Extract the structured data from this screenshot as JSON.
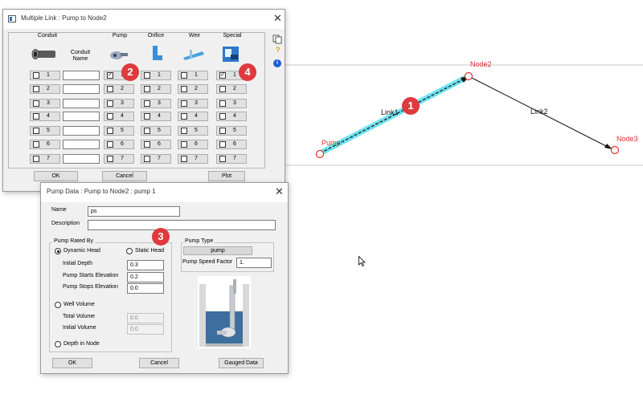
{
  "canvas": {
    "nodes": [
      {
        "name": "Pump",
        "color": "#e03030"
      },
      {
        "name": "Node2",
        "color": "#e03030"
      },
      {
        "name": "Node3",
        "color": "#e03030"
      }
    ],
    "links": [
      {
        "name": "Link1",
        "selected": true
      },
      {
        "name": "Link2",
        "selected": false
      }
    ],
    "highlight_color": "#6fe3ef"
  },
  "multiple_link": {
    "title": "Multiple Link : Pump to Node2",
    "columns": {
      "conduit": "Conduit",
      "pump": "Pump",
      "orifice": "Orifice",
      "weir": "Weir",
      "special": "Special"
    },
    "conduit_name_label": "Conduit Name",
    "rows": [
      {
        "number": "1",
        "pump_checked": true,
        "special_checked": true
      },
      {
        "number": "2",
        "pump_checked": false,
        "special_checked": false
      },
      {
        "number": "3",
        "pump_checked": false,
        "special_checked": false
      },
      {
        "number": "4",
        "pump_checked": false,
        "special_checked": false
      },
      {
        "number": "5",
        "pump_checked": false,
        "special_checked": false
      },
      {
        "number": "6",
        "pump_checked": false,
        "special_checked": false
      },
      {
        "number": "7",
        "pump_checked": false,
        "special_checked": false
      }
    ],
    "ok_label": "OK",
    "cancel_label": "Cancel",
    "plot_label": "Plot"
  },
  "pump_data": {
    "title": "Pump Data : Pump to Node2 : pump 1",
    "name_label": "Name",
    "name_value": "ps",
    "description_label": "Description",
    "description_value": "",
    "rated_by_title": "Pump Rated By",
    "dynamic_head_label": "Dynamic Head",
    "static_head_label": "Static Head",
    "initial_depth_label": "Initial Depth",
    "initial_depth_value": "0.3",
    "starts_elev_label": "Pump Starts Elevation",
    "starts_elev_value": "0.2",
    "stops_elev_label": "Pump Stops Elevation",
    "stops_elev_value": "0.0",
    "well_volume_label": "Well Volume",
    "total_volume_label": "Total Volume",
    "total_volume_value": "0.0",
    "initial_volume_label": "Initial Volume",
    "initial_volume_value": "0.0",
    "depth_in_node_label": "Depth in Node",
    "pump_type_title": "Pump Type",
    "pump_type_value": "pump",
    "speed_factor_label": "Pump Speed Factor",
    "speed_factor_value": "1.",
    "ok_label": "OK",
    "cancel_label": "Cancel",
    "gauged_label": "Gauged Data"
  },
  "badges": [
    "1",
    "2",
    "3",
    "4"
  ],
  "side_icons": [
    "copy-icon",
    "help-icon",
    "info-icon"
  ]
}
